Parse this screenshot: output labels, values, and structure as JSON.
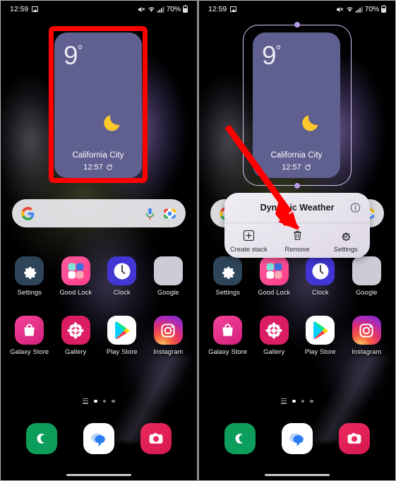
{
  "status_bar": {
    "time": "12:59",
    "battery": "70%",
    "icons": [
      "photo-icon",
      "mute-icon",
      "wifi-icon",
      "signal-icon",
      "battery-icon"
    ]
  },
  "widget": {
    "name": "Dynamic Weather",
    "temperature": "9",
    "degree": "°",
    "condition_icon": "moon-icon",
    "city": "California City",
    "updated_time": "12:57",
    "refresh_icon": "refresh-icon",
    "background_color": "#5f5f90"
  },
  "search": {
    "logo": "google-g-icon",
    "mic_icon": "microphone-icon",
    "lens_icon": "google-lens-icon",
    "placeholder": ""
  },
  "app_rows": [
    [
      {
        "label": "Settings",
        "icon": "settings-gear-icon"
      },
      {
        "label": "Good Lock",
        "icon": "good-lock-icon"
      },
      {
        "label": "Clock",
        "icon": "clock-icon"
      },
      {
        "label": "Google",
        "icon": "google-folder-icon"
      }
    ],
    [
      {
        "label": "Galaxy Store",
        "icon": "galaxy-store-icon"
      },
      {
        "label": "Gallery",
        "icon": "gallery-icon"
      },
      {
        "label": "Play Store",
        "icon": "play-store-icon"
      },
      {
        "label": "Instagram",
        "icon": "instagram-icon"
      }
    ]
  ],
  "dock": [
    {
      "label": "Phone",
      "icon": "phone-icon"
    },
    {
      "label": "Messages",
      "icon": "messages-icon"
    },
    {
      "label": "Camera",
      "icon": "camera-icon"
    }
  ],
  "page_indicator": {
    "pages": 3,
    "active": 1,
    "menu_icon": "app-list-icon"
  },
  "popup": {
    "title": "Dynamic Weather",
    "info_icon": "info-icon",
    "actions": [
      {
        "label": "Create stack",
        "icon": "plus-square-icon"
      },
      {
        "label": "Remove",
        "icon": "trash-icon"
      },
      {
        "label": "Settings",
        "icon": "gear-icon"
      }
    ]
  },
  "annotations": {
    "highlight_color": "#fe0000",
    "rect_target": "weather-widget",
    "arrow_target": "remove-action"
  }
}
